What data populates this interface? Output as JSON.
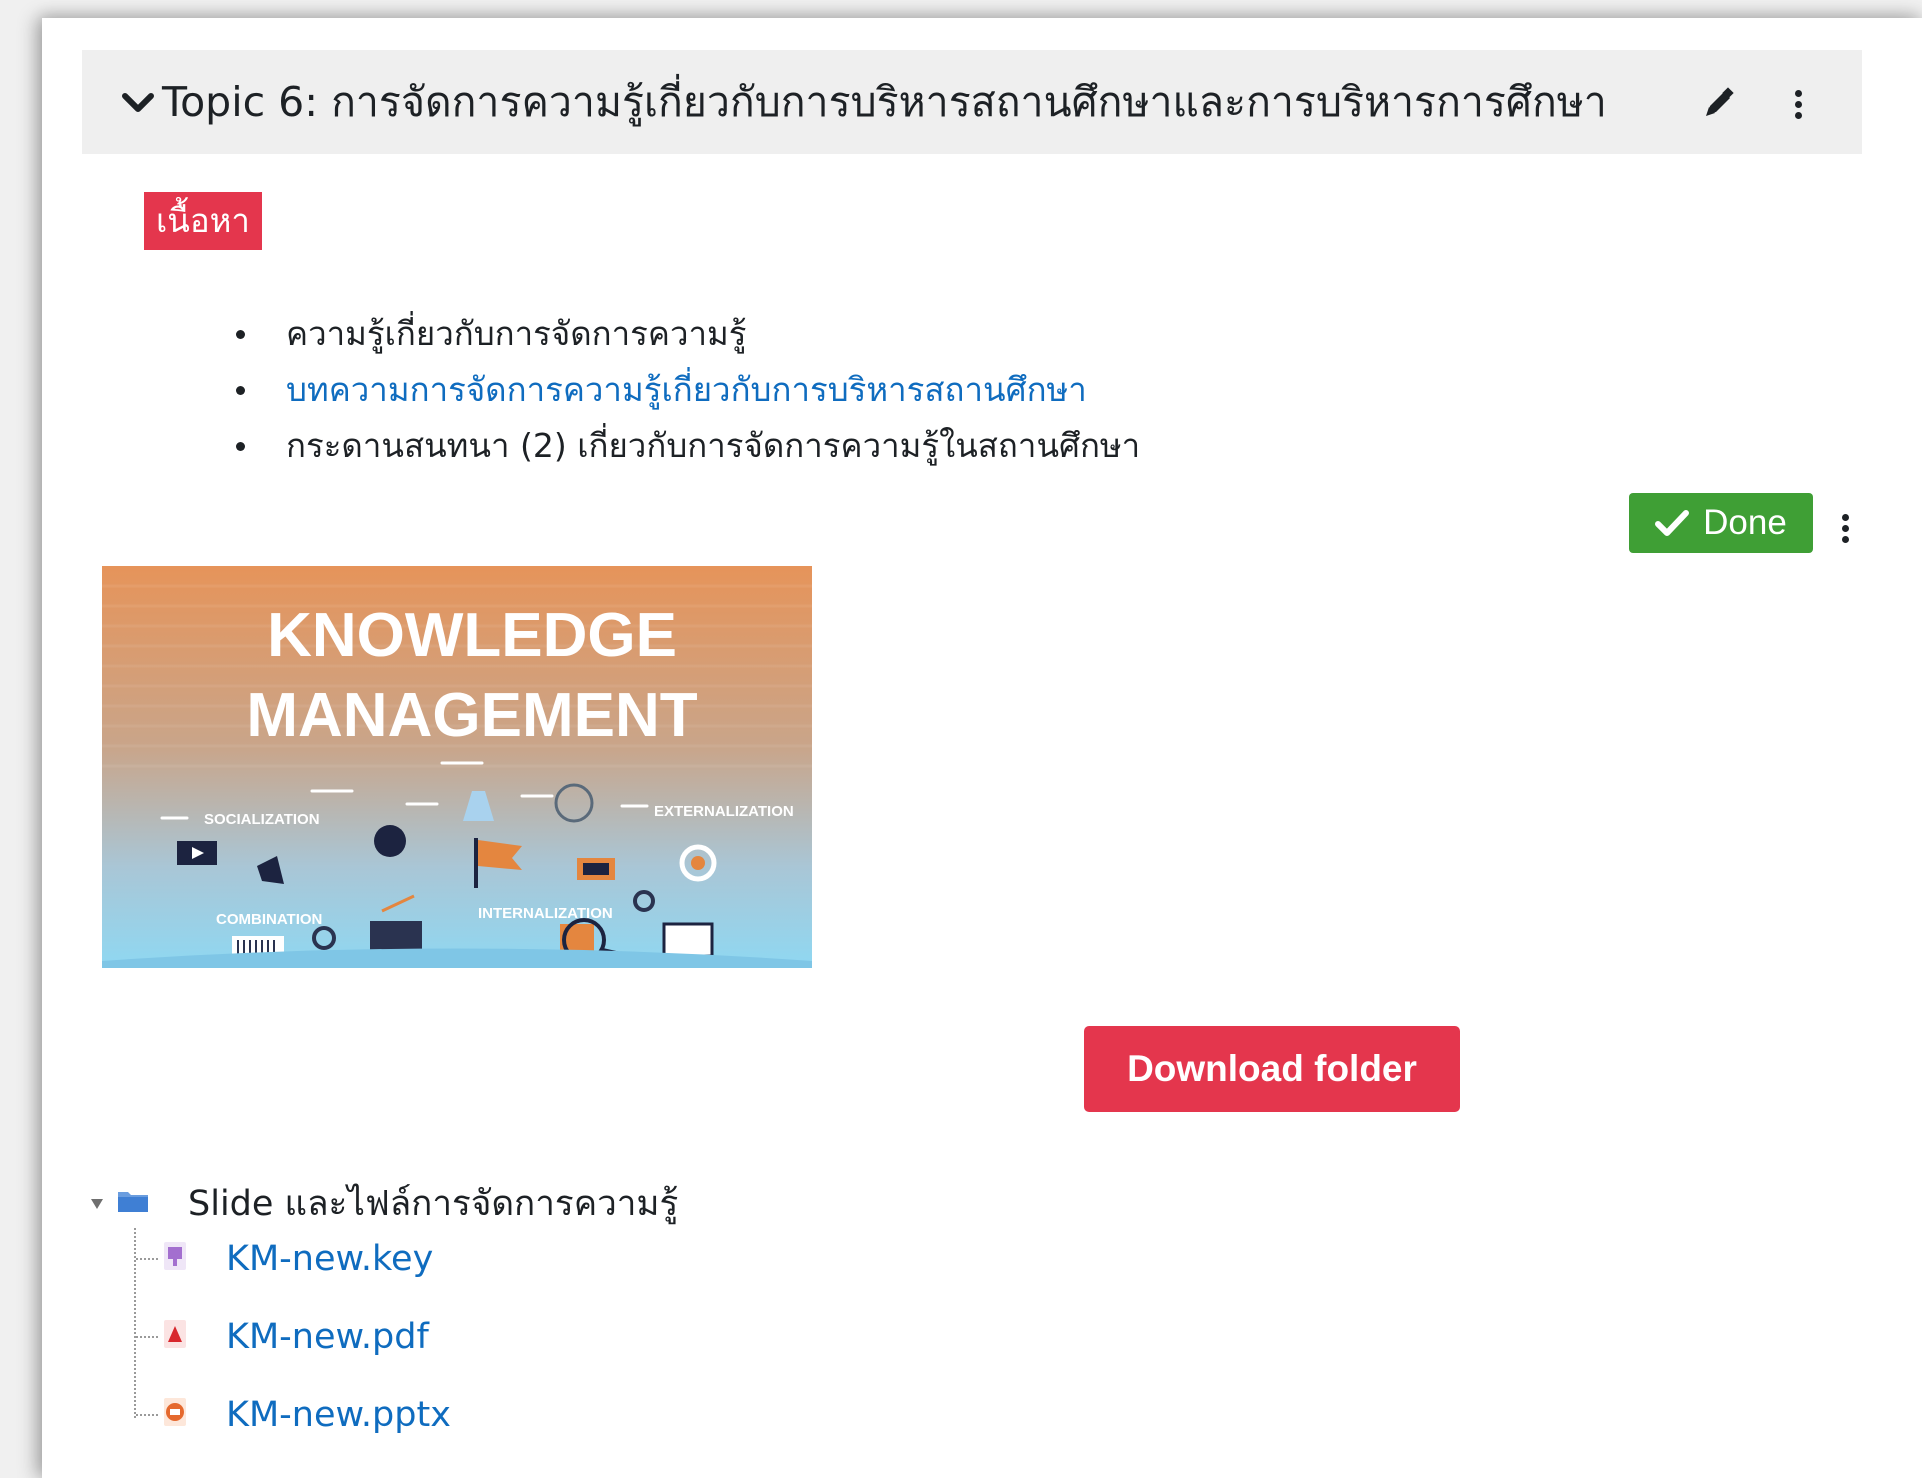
{
  "section": {
    "title": "Topic 6: การจัดการความรู้เกี่ยวกับการบริหารสถานศึกษาและการบริหารการศึกษา"
  },
  "content": {
    "badge": "เนื้อหา",
    "bullets": [
      {
        "text": "ความรู้เกี่ยวกับการจัดการความรู้",
        "is_link": false
      },
      {
        "text": "บทความการจัดการความรู้เกี่ยวกับการบริหารสถานศึกษา",
        "is_link": true
      },
      {
        "text": "กระดานสนทนา (2) เกี่ยวกับการจัดการความรู้ในสถานศึกษา",
        "is_link": false
      }
    ]
  },
  "completion": {
    "done_label": "Done"
  },
  "image": {
    "title_line1": "KNOWLEDGE",
    "title_line2": "MANAGEMENT",
    "labels": [
      "SOCIALIZATION",
      "EXTERNALIZATION",
      "INTERNALIZATION",
      "COMBINATION"
    ]
  },
  "folder": {
    "download_label": "Download folder",
    "name": "Slide และไฟล์การจัดการความรู้",
    "files": [
      {
        "name": "KM-new.key",
        "icon": "keynote-file-icon"
      },
      {
        "name": "KM-new.pdf",
        "icon": "pdf-file-icon"
      },
      {
        "name": "KM-new.pptx",
        "icon": "powerpoint-file-icon"
      }
    ]
  },
  "colors": {
    "link": "#0f6cbf",
    "badge": "#e4364d",
    "done": "#3f9f35",
    "header_bg": "#efefef"
  }
}
